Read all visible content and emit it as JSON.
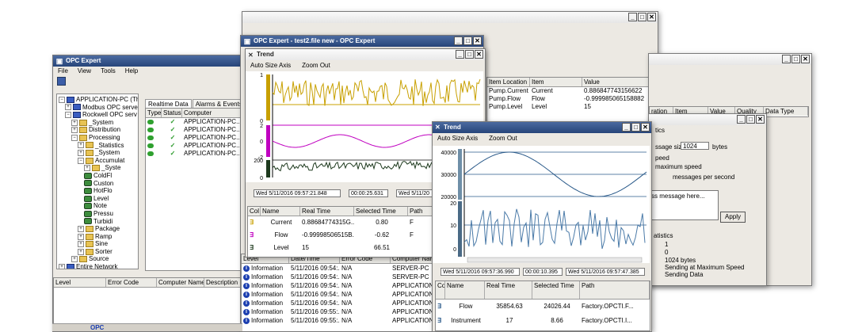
{
  "main_window": {
    "title": "OPC Expert",
    "menu": [
      "File",
      "View",
      "Tools",
      "Help"
    ],
    "tree": [
      {
        "label": "APPLICATION-PC (This",
        "indent": 0,
        "icon": "computer-icon"
      },
      {
        "label": "Modbus OPC server",
        "indent": 1,
        "icon": "server-icon"
      },
      {
        "label": "Rockwell OPC serv",
        "indent": 1,
        "icon": "server-icon"
      },
      {
        "label": "_System",
        "indent": 2,
        "icon": "folder-icon"
      },
      {
        "label": "Distribution",
        "indent": 2,
        "icon": "folder-icon"
      },
      {
        "label": "Processing",
        "indent": 2,
        "icon": "folder-icon"
      },
      {
        "label": "_Statistics",
        "indent": 3,
        "icon": "folder-icon"
      },
      {
        "label": "_System",
        "indent": 3,
        "icon": "folder-icon"
      },
      {
        "label": "Accumulat",
        "indent": 3,
        "icon": "folder-icon"
      },
      {
        "label": "_Syste",
        "indent": 4,
        "icon": "folder-icon"
      },
      {
        "label": "ColdFl",
        "indent": 4,
        "icon": "tag-icon"
      },
      {
        "label": "Custon",
        "indent": 4,
        "icon": "tag-icon"
      },
      {
        "label": "HotFlo",
        "indent": 4,
        "icon": "tag-icon"
      },
      {
        "label": "Level",
        "indent": 4,
        "icon": "tag-icon"
      },
      {
        "label": "Note",
        "indent": 4,
        "icon": "tag-icon"
      },
      {
        "label": "Pressu",
        "indent": 4,
        "icon": "tag-icon"
      },
      {
        "label": "Turbidi",
        "indent": 4,
        "icon": "tag-icon"
      },
      {
        "label": "Package",
        "indent": 3,
        "icon": "folder-icon"
      },
      {
        "label": "Ramp",
        "indent": 3,
        "icon": "folder-icon"
      },
      {
        "label": "Sine",
        "indent": 3,
        "icon": "folder-icon"
      },
      {
        "label": "Sorter",
        "indent": 3,
        "icon": "folder-icon"
      },
      {
        "label": "Source",
        "indent": 2,
        "icon": "folder-icon"
      },
      {
        "label": "Entire Network",
        "indent": 0,
        "icon": "network-icon"
      }
    ],
    "tabs": [
      "Realtime Data",
      "Alarms & Events"
    ],
    "status_headers": [
      "Type",
      "Status",
      "Computer"
    ],
    "status_rows": [
      "APPLICATION-PC...",
      "APPLICATION-PC...",
      "APPLICATION-PC...",
      "APPLICATION-PC...",
      "APPLICATION-PC..."
    ],
    "bottom_headers": [
      "Level",
      "Error Code",
      "Computer Name",
      "Description"
    ]
  },
  "back_window": {
    "item_headers": [
      "Item Location",
      "Item",
      "Value"
    ],
    "items": [
      {
        "location": "Pump.Current",
        "item": "Current",
        "value": "0.886847743156622"
      },
      {
        "location": "Pump.Flow",
        "item": "Flow",
        "value": "-0.999985065158882"
      },
      {
        "location": "Pump.Level",
        "item": "Level",
        "value": "15"
      }
    ]
  },
  "right_window": {
    "headers": [
      "ration",
      "Item",
      "Value",
      "Quality",
      "Data Type"
    ],
    "lines": [
      "tics",
      "ssage size",
      "1024",
      "bytes",
      "peed",
      "maximum speed",
      "messages per second",
      "ss message here...",
      "Apply",
      "atistics",
      "1",
      "0",
      "1024 bytes",
      "Sending at Maximum Speed",
      "Sending Data"
    ]
  },
  "trend1": {
    "title": "Trend",
    "toolbar": [
      "Auto Size Axis",
      "Zoom Out"
    ],
    "axes": [
      {
        "labels": [
          "1",
          "0"
        ],
        "color": "#c8a000"
      },
      {
        "labels": [
          "2",
          "0",
          "-2"
        ],
        "color": "#c000c0"
      },
      {
        "labels": [
          "200",
          "0"
        ],
        "color": "#1e3a1e"
      }
    ],
    "start_time": "Wed 5/11/2016 09:57:21.848",
    "span": "00:00:25.631",
    "end_time": "Wed 5/11/20",
    "table_headers": [
      "Col",
      "Name",
      "Real Time",
      "Selected Time",
      "Path"
    ],
    "rows": [
      {
        "name": "Current",
        "real": "0.88684774315G...",
        "selected": "0.80",
        "path": "F"
      },
      {
        "name": "Flow",
        "real": "-0.99998506515B...",
        "selected": "-0.62",
        "path": "F"
      },
      {
        "name": "Level",
        "real": "15",
        "selected": "66.51",
        "path": ""
      }
    ]
  },
  "middle_window": {
    "title": "OPC Expert - test2.file new - OPC Expert",
    "log_headers": [
      "Level",
      "Date/Time",
      "Error Code",
      "Computer Name"
    ],
    "log_rows": [
      {
        "level": "Information",
        "date": "5/11/2016 09:54:...",
        "code": "N/A",
        "computer": "SERVER-PC"
      },
      {
        "level": "Information",
        "date": "5/11/2016 09:54:...",
        "code": "N/A",
        "computer": "SERVER-PC"
      },
      {
        "level": "Information",
        "date": "5/11/2016 09:54:...",
        "code": "N/A",
        "computer": "APPLICATION-..."
      },
      {
        "level": "Information",
        "date": "5/11/2016 09:54:...",
        "code": "N/A",
        "computer": "APPLICATION-..."
      },
      {
        "level": "Information",
        "date": "5/11/2016 09:54:...",
        "code": "N/A",
        "computer": "APPLICATION-..."
      },
      {
        "level": "Information",
        "date": "5/11/2016 09:55:...",
        "code": "N/A",
        "computer": "APPLICATION-..."
      },
      {
        "level": "Information",
        "date": "5/11/2016 09:55:...",
        "code": "N/A",
        "computer": "APPLICATION-..."
      }
    ]
  },
  "trend2": {
    "title": "Trend",
    "toolbar": [
      "Auto Size Axis",
      "Zoom Out"
    ],
    "y_labels_upper": [
      "40000",
      "30000",
      "20000"
    ],
    "y_labels_lower": [
      "20",
      "10",
      "0"
    ],
    "start_time": "Wed 5/11/2016 09:57:36.990",
    "span": "00:00:10.395",
    "end_time": "Wed 5/11/2016 09:57:47.385",
    "table_headers": [
      "Co",
      "Name",
      "Real Time",
      "Selected Time",
      "Path"
    ],
    "rows": [
      {
        "name": "Flow",
        "real": "35854.63",
        "selected": "24026.44",
        "path": "Factory.OPCTI.F..."
      },
      {
        "name": "Instrument",
        "real": "17",
        "selected": "8.66",
        "path": "Factory.OPCTI.I..."
      }
    ]
  },
  "taskbar_label": "OPC"
}
